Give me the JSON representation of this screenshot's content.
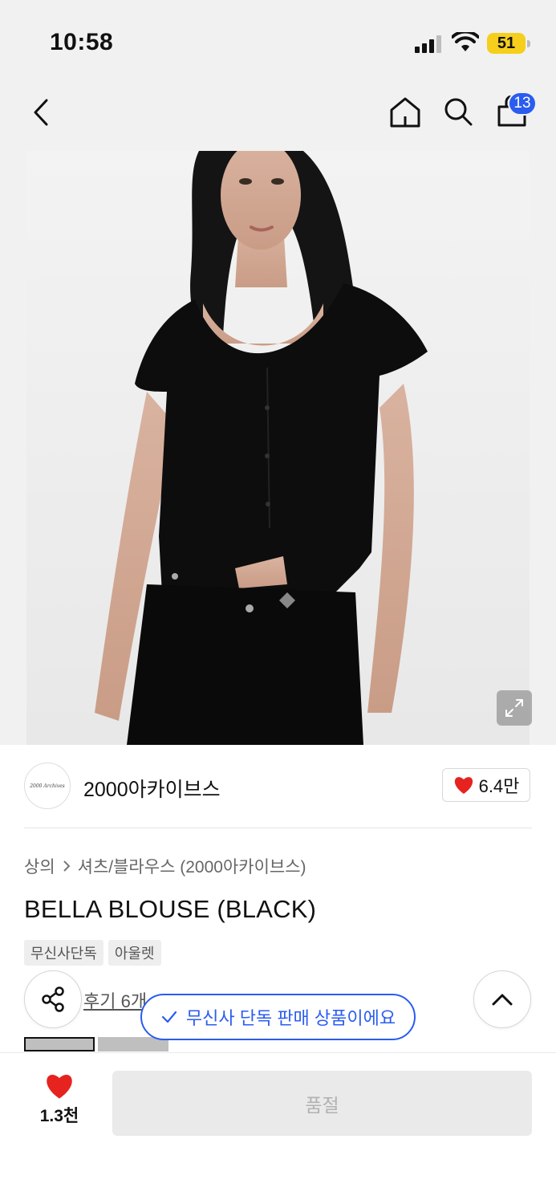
{
  "status_bar": {
    "time": "10:58",
    "battery": "51"
  },
  "nav": {
    "cart_count": "13"
  },
  "brand": {
    "logo_text": "2000 Archives",
    "name": "2000아카이브스",
    "likes": "6.4만"
  },
  "product": {
    "breadcrumb": [
      "상의",
      "셔츠/블라우스 (2000아카이브스)"
    ],
    "title": "BELLA BLOUSE (BLACK)",
    "tags": [
      "무신사단독",
      "아울렛"
    ],
    "review_link": "후기 6개"
  },
  "toast": {
    "text": "무신사 단독 판매 상품이에요"
  },
  "bottom": {
    "wish_count": "1.3천",
    "buy_label": "품절"
  },
  "colors": {
    "accent": "#2a5cf0",
    "heart": "#e6231f",
    "battery": "#f5cf1c"
  }
}
